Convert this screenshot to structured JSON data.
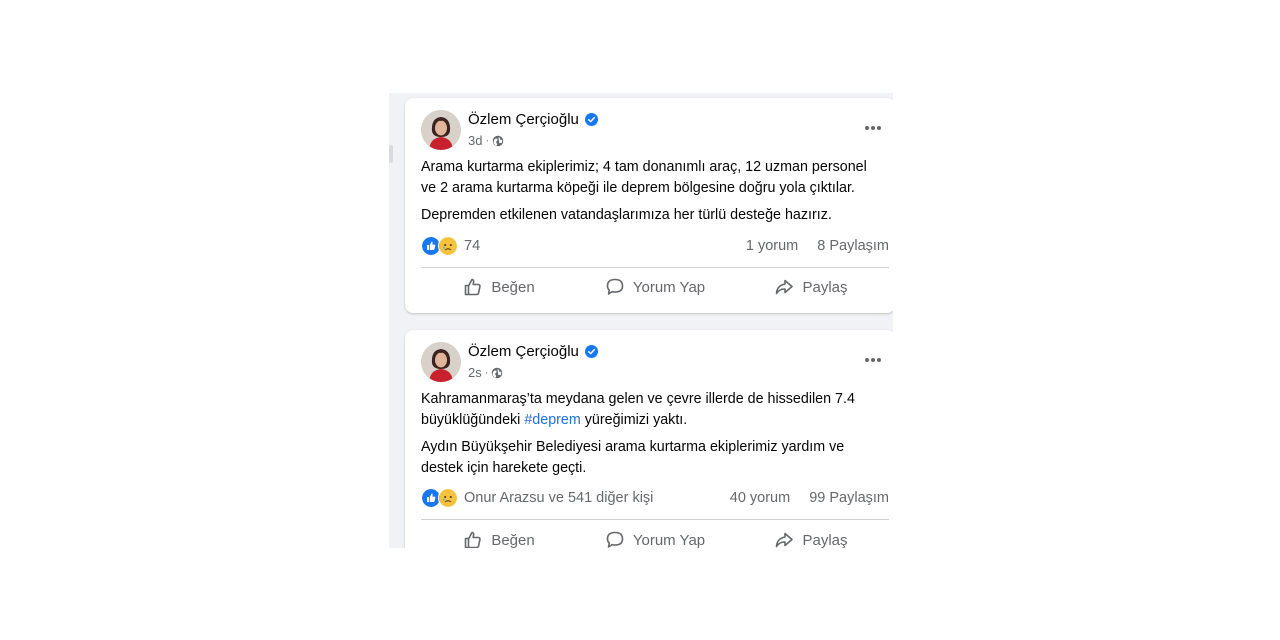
{
  "posts": [
    {
      "author": "Özlem Çerçioğlu",
      "time": "3d",
      "paragraphs": [
        "Arama kurtarma ekiplerimiz; 4 tam donanımlı araç, 12 uzman personel ve 2 arama kurtarma köpeği ile deprem bölgesine doğru yola çıktılar.",
        "Depremden etkilenen vatandaşlarımıza her türlü desteğe hazırız."
      ],
      "reactions_count": "74",
      "comments": "1 yorum",
      "shares": "8 Paylaşım",
      "actions": {
        "like": "Beğen",
        "comment": "Yorum Yap",
        "share": "Paylaş"
      }
    },
    {
      "author": "Özlem Çerçioğlu",
      "time": "2s",
      "paragraph1_before": "Kahramanmaraş’ta meydana gelen ve çevre illerde de hissedilen 7.4 büyüklüğündeki ",
      "hashtag": "#deprem",
      "paragraph1_after": " yüreğimizi yaktı.",
      "paragraph2": "Aydın Büyükşehir Belediyesi arama kurtarma ekiplerimiz yardım ve destek için harekete geçti.",
      "reactions_count": "Onur Arazsu ve 541 diğer kişi",
      "comments": "40 yorum",
      "shares": "99 Paylaşım",
      "actions": {
        "like": "Beğen",
        "comment": "Yorum Yap",
        "share": "Paylaş"
      }
    }
  ],
  "icons": {
    "verified": "verified-badge-icon",
    "privacy": "globe-icon",
    "more": "more-horizontal-icon",
    "like_reaction": "like-reaction-icon",
    "sad_reaction": "sad-reaction-icon",
    "like": "thumbs-up-icon",
    "comment": "comment-bubble-icon",
    "share": "share-arrow-icon"
  },
  "colors": {
    "verified": "#1877f2",
    "hashtag": "#216fdb",
    "secondary_text": "#65676b",
    "feed_bg": "#f0f2f5"
  }
}
